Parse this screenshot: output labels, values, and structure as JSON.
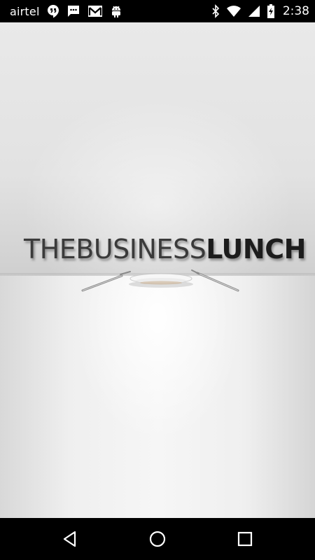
{
  "status_bar": {
    "carrier": "airtel",
    "left_icons": [
      "hangouts-icon",
      "sms-icon",
      "gmail-icon",
      "android-icon"
    ],
    "right_icons": [
      "bluetooth-icon",
      "wifi-icon",
      "cell-signal-icon",
      "battery-charging-icon"
    ],
    "time": "2:38"
  },
  "splash": {
    "logo_light": "THEBUSINESS",
    "logo_bold": "LUNCH",
    "background_colors": {
      "wall": "#e2e2e2",
      "floor": "#f3f3f3",
      "logo": "#2b2b2b"
    },
    "graphic": "plate-with-knife-and-fork"
  },
  "nav_bar": {
    "buttons": [
      "back-icon",
      "home-icon",
      "recents-icon"
    ]
  }
}
